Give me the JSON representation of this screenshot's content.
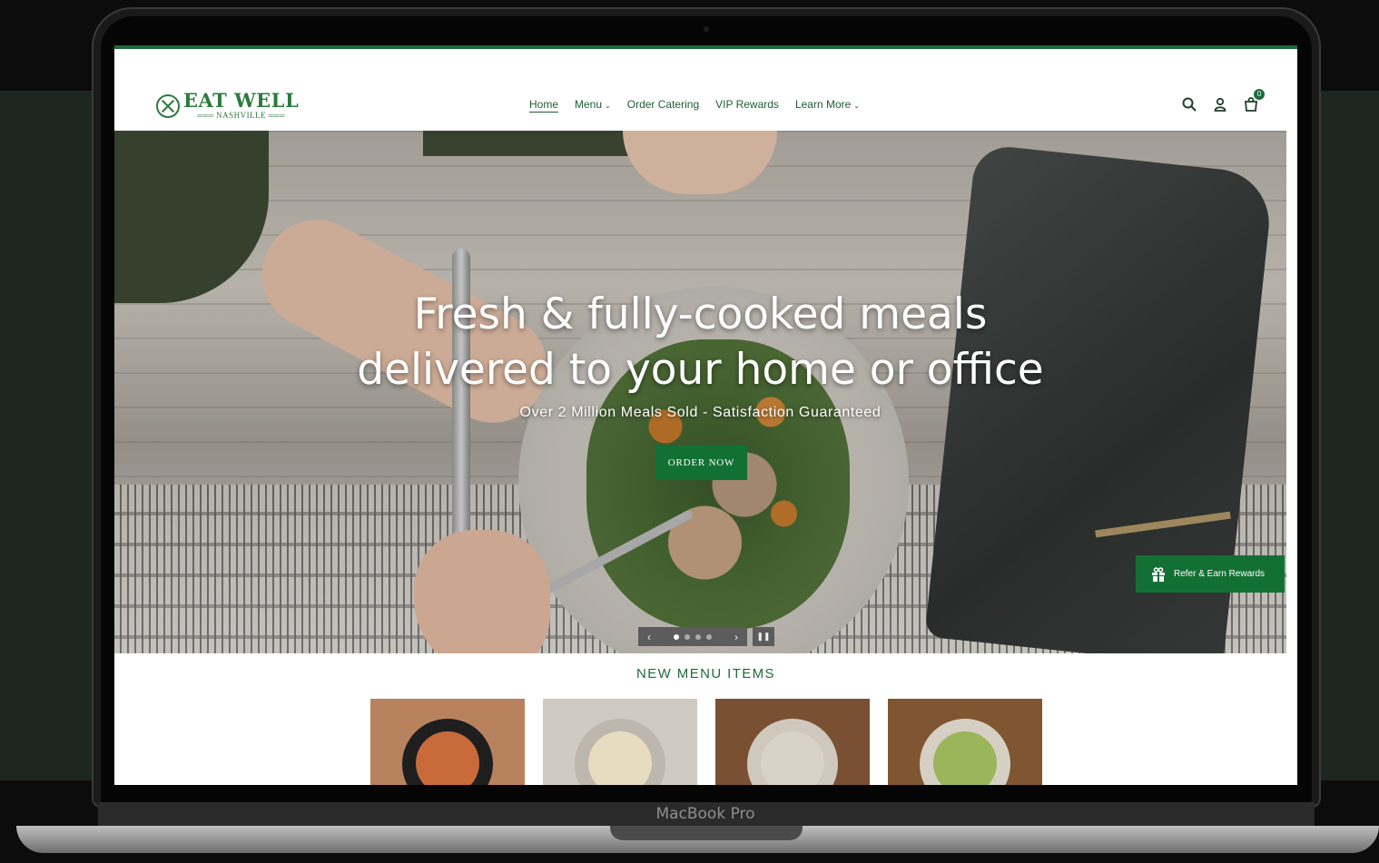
{
  "laptop": {
    "label": "MacBook Pro"
  },
  "site": {
    "logo": {
      "main": "EAT WELL",
      "sub": "NASHVILLE",
      "brand_color": "#2c7a3d"
    },
    "nav": [
      {
        "label": "Home",
        "active": true
      },
      {
        "label": "Menu",
        "dropdown": true
      },
      {
        "label": "Order Catering"
      },
      {
        "label": "VIP Rewards"
      },
      {
        "label": "Learn More",
        "dropdown": true
      }
    ],
    "header_icons": [
      "search-icon",
      "account-icon",
      "cart-icon"
    ],
    "cart_count": "0",
    "accent_color": "#137034"
  },
  "hero": {
    "title_line1": "Fresh & fully-cooked meals",
    "title_line2": "delivered to your home or office",
    "subtitle": "Over 2 Million Meals Sold - Satisfaction Guaranteed",
    "cta": "ORDER NOW",
    "slide_count": 4,
    "active_slide": 1,
    "refer_label": "Refer & Earn Rewards"
  },
  "menu_section": {
    "title": "NEW MENU ITEMS",
    "items": [
      {
        "bg": "#b8825e",
        "bowl": "#1e1e1e",
        "fill": "#c96a3a"
      },
      {
        "bg": "#cfcac2",
        "bowl": "#bdb7ad",
        "fill": "#e7dcc0"
      },
      {
        "bg": "#7a5033",
        "bowl": "#cfc9bd",
        "fill": "#d9d3c7"
      },
      {
        "bg": "#805532",
        "bowl": "#d6d0c4",
        "fill": "#9ab55a"
      }
    ]
  }
}
